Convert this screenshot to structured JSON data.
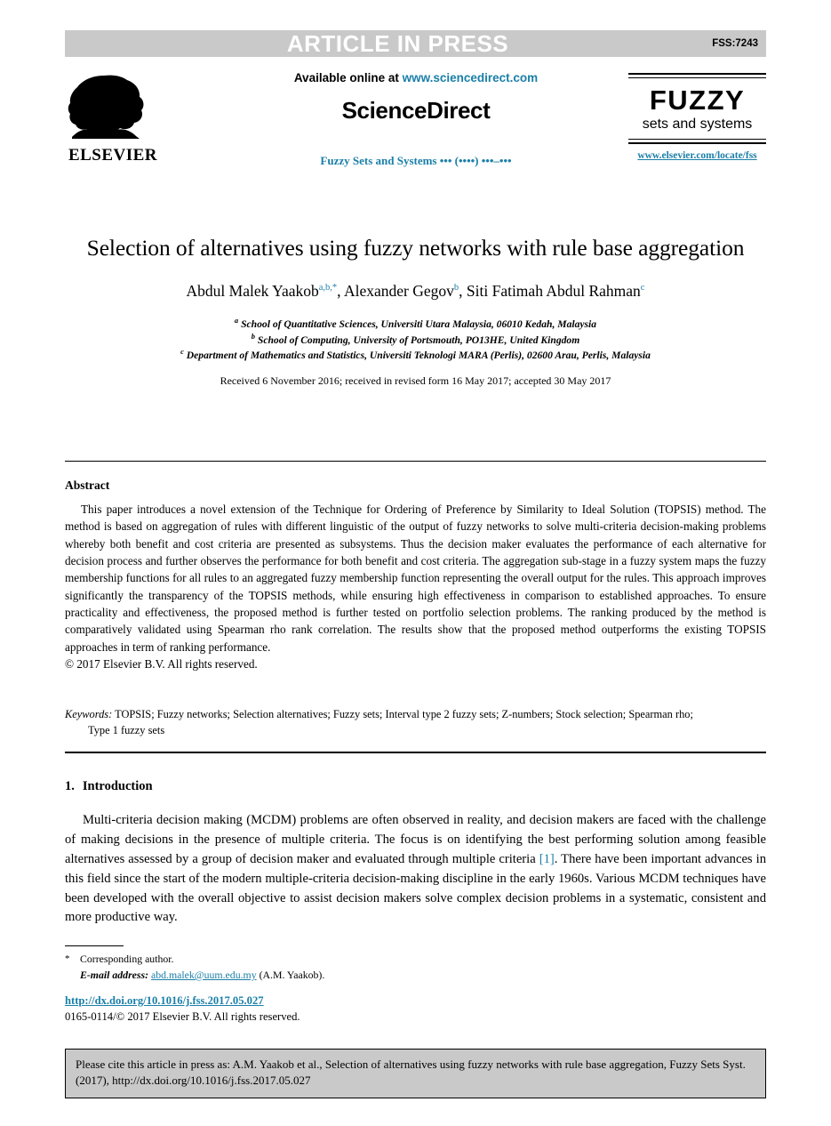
{
  "header": {
    "banner_text": "ARTICLE IN PRESS",
    "article_code": "FSS:7243"
  },
  "masthead": {
    "publisher_name": "ELSEVIER",
    "available_prefix": "Available online at ",
    "available_link": "www.sciencedirect.com",
    "platform_name": "ScienceDirect",
    "journal_citation": "Fuzzy Sets and Systems ••• (••••) •••–•••",
    "journal_logo_word": "FUZZY",
    "journal_logo_sub": "sets and systems",
    "journal_url": "www.elsevier.com/locate/fss"
  },
  "article": {
    "title": "Selection of alternatives using fuzzy networks with rule base aggregation",
    "authors": [
      {
        "name": "Abdul Malek Yaakob",
        "marks": "a,b,*",
        "sep": ", "
      },
      {
        "name": "Alexander Gegov",
        "marks": "b",
        "sep": ", "
      },
      {
        "name": "Siti Fatimah Abdul Rahman",
        "marks": "c",
        "sep": ""
      }
    ],
    "affiliations": [
      {
        "mark": "a",
        "text": "School of Quantitative Sciences, Universiti Utara Malaysia, 06010 Kedah, Malaysia"
      },
      {
        "mark": "b",
        "text": "School of Computing, University of Portsmouth, PO13HE, United Kingdom"
      },
      {
        "mark": "c",
        "text": "Department of Mathematics and Statistics, Universiti Teknologi MARA (Perlis), 02600 Arau, Perlis, Malaysia"
      }
    ],
    "history": "Received 6 November 2016; received in revised form 16 May 2017; accepted 30 May 2017"
  },
  "abstract": {
    "heading": "Abstract",
    "text": "This paper introduces a novel extension of the Technique for Ordering of Preference by Similarity to Ideal Solution (TOPSIS) method. The method is based on aggregation of rules with different linguistic of the output of fuzzy networks to solve multi-criteria decision-making problems whereby both benefit and cost criteria are presented as subsystems. Thus the decision maker evaluates the performance of each alternative for decision process and further observes the performance for both benefit and cost criteria. The aggregation sub-stage in a fuzzy system maps the fuzzy membership functions for all rules to an aggregated fuzzy membership function representing the overall output for the rules. This approach improves significantly the transparency of the TOPSIS methods, while ensuring high effectiveness in comparison to established approaches. To ensure practicality and effectiveness, the proposed method is further tested on portfolio selection problems. The ranking produced by the method is comparatively validated using Spearman rho rank correlation. The results show that the proposed method outperforms the existing TOPSIS approaches in term of ranking performance.",
    "copyright": "© 2017 Elsevier B.V. All rights reserved."
  },
  "keywords": {
    "label": "Keywords:",
    "line1": " TOPSIS; Fuzzy networks; Selection alternatives; Fuzzy sets; Interval type 2 fuzzy sets; Z-numbers; Stock selection; Spearman rho;",
    "line2": "Type 1 fuzzy sets"
  },
  "introduction": {
    "number": "1.",
    "heading": "Introduction",
    "text_part1": "Multi-criteria decision making (MCDM) problems are often observed in reality, and decision makers are faced with the challenge of making decisions in the presence of multiple criteria. The focus is on identifying the best performing solution among feasible alternatives assessed by a group of decision maker and evaluated through multiple criteria ",
    "citation": "[1]",
    "text_part2": ". There have been important advances in this field since the start of the modern multiple-criteria decision-making discipline in the early 1960s. Various MCDM techniques have been developed with the overall objective to assist decision makers solve complex decision problems in a systematic, consistent and more productive way."
  },
  "footnote": {
    "star": "*",
    "corresponding": "Corresponding author.",
    "email_label": "E-mail address:",
    "email": "abd.malek@uum.edu.my",
    "email_attrib": "(A.M. Yaakob).",
    "doi": "http://dx.doi.org/10.1016/j.fss.2017.05.027",
    "issn": "0165-0114/© 2017 Elsevier B.V. All rights reserved."
  },
  "citation_box": {
    "text": "Please cite this article in press as: A.M. Yaakob et al., Selection of alternatives using fuzzy networks with rule base aggregation, Fuzzy Sets Syst. (2017), http://dx.doi.org/10.1016/j.fss.2017.05.027"
  },
  "colors": {
    "link": "#1a7fa8",
    "banner_bg": "#c9c9c9",
    "banner_text": "#ffffff",
    "citebox_bg": "#c9c9c9"
  }
}
